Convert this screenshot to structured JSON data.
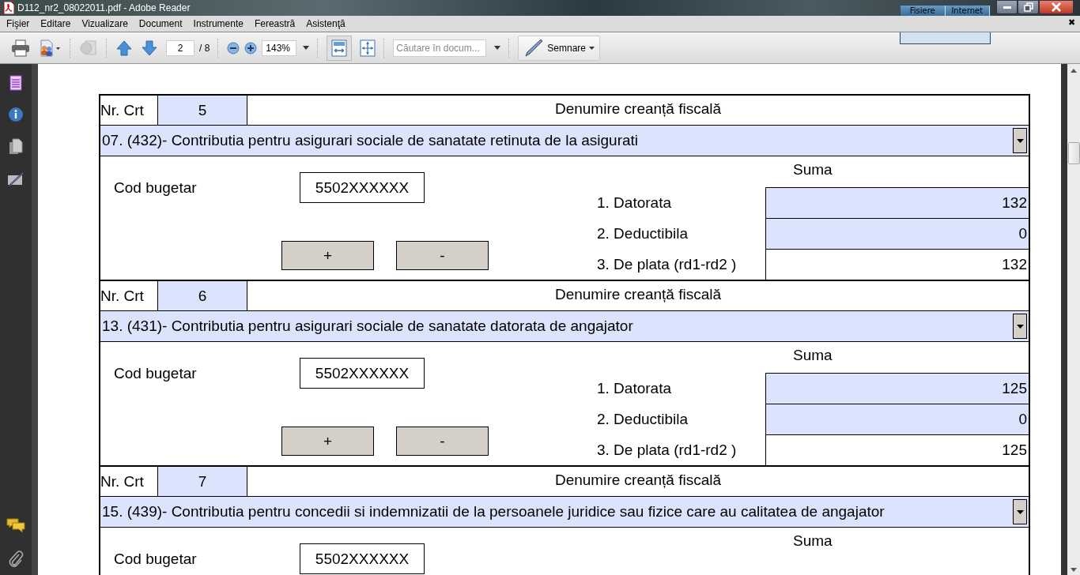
{
  "window": {
    "title": "D112_nr2_08022011.pdf - Adobe Reader"
  },
  "gadget": {
    "columns": [
      "Fisiere",
      "Internet"
    ]
  },
  "menu": [
    "Fişier",
    "Editare",
    "Vizualizare",
    "Document",
    "Instrumente",
    "Fereastră",
    "Asistenţă"
  ],
  "menu_close": "✖",
  "toolbar": {
    "page": "2",
    "page_total": "/ 8",
    "zoom": "143%",
    "search": {
      "placeholder": "Căutare în docum..."
    },
    "sign_button": "Semnare",
    "fit_width_selected": true
  },
  "blocks": [
    {
      "nr_label": "Nr. Crt",
      "nr": "5",
      "name_label": "Denumire creanță fiscală",
      "selection": "07. (432)- Contributia pentru asigurari sociale de sanatate retinuta de la asigurati",
      "code_label": "Cod bugetar",
      "code": "5502XXXXXX",
      "add": "+",
      "remove": "-",
      "sum_label": "Suma",
      "rows": [
        {
          "label": "1. Datorata",
          "value": "132",
          "shaded": true
        },
        {
          "label": "2. Deductibila",
          "value": "0",
          "shaded": true
        },
        {
          "label": "3. De plata (rd1-rd2 )",
          "value": "132",
          "shaded": false
        }
      ]
    },
    {
      "nr_label": "Nr. Crt",
      "nr": "6",
      "name_label": "Denumire creanță fiscală",
      "selection": "13. (431)- Contributia pentru asigurari sociale de sanatate datorata de angajator",
      "code_label": "Cod bugetar",
      "code": "5502XXXXXX",
      "add": "+",
      "remove": "-",
      "sum_label": "Suma",
      "rows": [
        {
          "label": "1. Datorata",
          "value": "125",
          "shaded": true
        },
        {
          "label": "2. Deductibila",
          "value": "0",
          "shaded": true
        },
        {
          "label": "3. De plata (rd1-rd2 )",
          "value": "125",
          "shaded": false
        }
      ]
    },
    {
      "nr_label": "Nr. Crt",
      "nr": "7",
      "name_label": "Denumire creanță fiscală",
      "selection": "15. (439)- Contributia pentru concedii si indemnizatii de la persoanele juridice sau fizice care au calitatea de angajator",
      "code_label": "Cod bugetar",
      "code": "5502XXXXXX",
      "sum_label": "Suma"
    }
  ]
}
